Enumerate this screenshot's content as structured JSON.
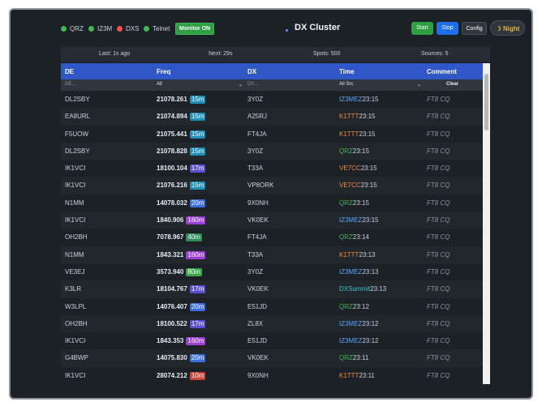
{
  "indicators": [
    {
      "label": "QRZ",
      "color": "#3fb950"
    },
    {
      "label": "IZ3M",
      "color": "#3fb950"
    },
    {
      "label": "DXS",
      "color": "#f85149"
    },
    {
      "label": "Telnet",
      "color": "#3fb950"
    }
  ],
  "monitor_label": "Monitor ON",
  "title": "DX Cluster",
  "buttons": {
    "start": "Start",
    "stop": "Stop",
    "config": "Config",
    "night": "Night"
  },
  "stats": {
    "last": "Last: 1s ago",
    "next": "Next: 29s",
    "spots": "Spots: 500",
    "sources": "Sources: 5"
  },
  "columns": {
    "de": "DE",
    "freq": "Freq",
    "dx": "DX",
    "time": "Time",
    "comment": "Comment"
  },
  "filters": {
    "de_placeholder": "DE...",
    "freq_value": "All",
    "dx_placeholder": "DX...",
    "src_value": "All Src",
    "clear_label": "Clear"
  },
  "band_colors": {
    "15m": "#1f8fb8",
    "17m": "#5a52d5",
    "20m": "#3b6fe0",
    "160m": "#9b3fd6",
    "40m": "#2c8c5a",
    "80m": "#3aa84a",
    "10m": "#c8453b"
  },
  "source_colors": {
    "IZ3MEZ": "#58a6ff",
    "K1TTT": "#f0883e",
    "QRZ": "#3fb950",
    "VE7CC": "#f0883e",
    "DXSummit": "#39c5cf"
  },
  "spots": [
    {
      "de": "DL2SBY",
      "freq": "21078.261",
      "band": "15m",
      "dx": "3Y0Z",
      "src": "IZ3MEZ",
      "time": "23:15",
      "comment": "FT8 CQ"
    },
    {
      "de": "EA8URL",
      "freq": "21074.894",
      "band": "15m",
      "dx": "A25RJ",
      "src": "K1TTT",
      "time": "23:15",
      "comment": "FT8 CQ"
    },
    {
      "de": "F5UOW",
      "freq": "21075.441",
      "band": "15m",
      "dx": "FT4JA",
      "src": "K1TTT",
      "time": "23:15",
      "comment": "FT8 CQ"
    },
    {
      "de": "DL2SBY",
      "freq": "21078.828",
      "band": "15m",
      "dx": "3Y0Z",
      "src": "QRZ",
      "time": "23:15",
      "comment": "FT8 CQ"
    },
    {
      "de": "IK1VCI",
      "freq": "18100.104",
      "band": "17m",
      "dx": "T33A",
      "src": "VE7CC",
      "time": "23:15",
      "comment": "FT8 CQ"
    },
    {
      "de": "IK1VCI",
      "freq": "21076.216",
      "band": "15m",
      "dx": "VP8ORK",
      "src": "VE7CC",
      "time": "23:15",
      "comment": "FT8 CQ"
    },
    {
      "de": "N1MM",
      "freq": "14078.032",
      "band": "20m",
      "dx": "9X0NH",
      "src": "QRZ",
      "time": "23:15",
      "comment": "FT8 CQ"
    },
    {
      "de": "IK1VCI",
      "freq": "1840.906",
      "band": "160m",
      "dx": "VK0EK",
      "src": "IZ3MEZ",
      "time": "23:15",
      "comment": "FT8 CQ"
    },
    {
      "de": "OH2BH",
      "freq": "7078.967",
      "band": "40m",
      "dx": "FT4JA",
      "src": "QRZ",
      "time": "23:14",
      "comment": "FT8 CQ"
    },
    {
      "de": "N1MM",
      "freq": "1843.321",
      "band": "160m",
      "dx": "T33A",
      "src": "K1TTT",
      "time": "23:13",
      "comment": "FT8 CQ"
    },
    {
      "de": "VE3EJ",
      "freq": "3573.940",
      "band": "80m",
      "dx": "3Y0Z",
      "src": "IZ3MEZ",
      "time": "23:13",
      "comment": "FT8 CQ"
    },
    {
      "de": "K3LR",
      "freq": "18104.767",
      "band": "17m",
      "dx": "VK0EK",
      "src": "DXSummit",
      "time": "23:13",
      "comment": "FT8 CQ"
    },
    {
      "de": "W3LPL",
      "freq": "14076.407",
      "band": "20m",
      "dx": "E51JD",
      "src": "QRZ",
      "time": "23:12",
      "comment": "FT8 CQ"
    },
    {
      "de": "OH2BH",
      "freq": "18100.522",
      "band": "17m",
      "dx": "ZL8X",
      "src": "IZ3MEZ",
      "time": "23:12",
      "comment": "FT8 CQ"
    },
    {
      "de": "IK1VCI",
      "freq": "1843.353",
      "band": "160m",
      "dx": "E51JD",
      "src": "IZ3MEZ",
      "time": "23:12",
      "comment": "FT8 CQ"
    },
    {
      "de": "G4BWP",
      "freq": "14075.830",
      "band": "20m",
      "dx": "VK0EK",
      "src": "QRZ",
      "time": "23:11",
      "comment": "FT8 CQ"
    },
    {
      "de": "IK1VCI",
      "freq": "28074.212",
      "band": "10m",
      "dx": "9X0NH",
      "src": "K1TTT",
      "time": "23:11",
      "comment": "FT8 CQ"
    }
  ]
}
